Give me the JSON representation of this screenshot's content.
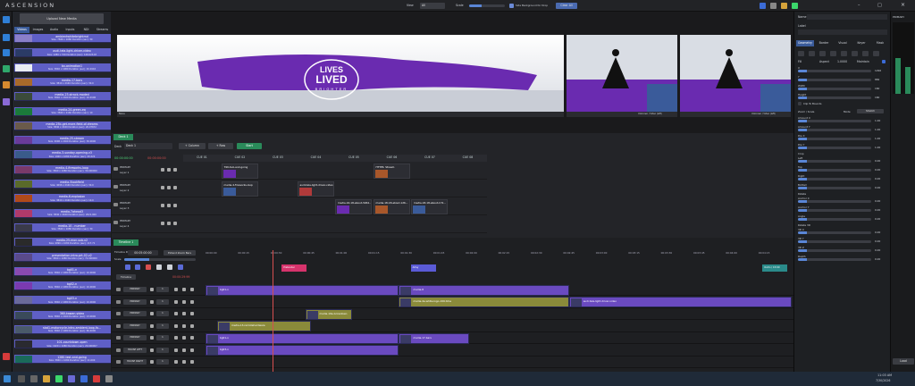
{
  "app": {
    "title": "ASCENSION"
  },
  "topbar": {
    "view_label": "View",
    "view_value": "All",
    "scale_label": "Scale",
    "scale_fraction": 0.35,
    "side_bg_label": "Side Background for Drop",
    "clear_all_label": "Clear All"
  },
  "media": {
    "upload_label": "Upload New Media",
    "tabs": [
      "Videos",
      "Images",
      "Audio",
      "Inputs",
      "NDI",
      "Streams"
    ],
    "items": [
      {
        "title": "ambientwhitebrightmd",
        "info": "Size: 7826 x 1080 Duration (sec): 30",
        "color": "#8a7fc8"
      },
      {
        "title": "audi-tela-light-driver-video",
        "info": "Size: 1280 x 720 Duration (sec): 126.023.67",
        "color": "#2b3b66"
      },
      {
        "title": "bx-animation1",
        "info": "Size: 3840 x 1080 Duration (sec): 40.0416",
        "color": "#e9ecf2"
      },
      {
        "title": "media-17-bars",
        "info": "Size: 3840 x 2160 Duration (sec): 30.0",
        "color": "#a86a2a"
      },
      {
        "title": "media-23-strack-moded",
        "info": "Size: 3840 x 2160 Duration (sec): 10.0106",
        "color": "#3b4b3a"
      },
      {
        "title": "media-24-green-eq",
        "info": "Size: 3840 x 2160 Duration (sec): 10",
        "color": "#1b7a3a"
      },
      {
        "title": "media-25b-get-more-field-of-dreams",
        "info": "Size: 3840 x 2160 Duration (sec): 20.07672",
        "color": "#6a5a4a"
      },
      {
        "title": "media-25-stream",
        "info": "Size: 4096 x 2160 Duration (sec): 30.0000",
        "color": "#6a3b9a"
      },
      {
        "title": "media-3-sunday-opening-v3",
        "info": "Size: 1920 x 1080 Duration (sec): 20.222",
        "color": "#3a5b8a"
      },
      {
        "title": "media-4-fireworks-loop",
        "info": "Size: 3840 x 1080 Duration (sec): 30.000000",
        "color": "#7a3a6a"
      },
      {
        "title": "media-5lookfield",
        "info": "Size: 4096 x 2160 Duration (sec): 30.0",
        "color": "#5a6a2a"
      },
      {
        "title": "media-6-explosion",
        "info": "Size: 3840 x 2160 Duration (sec): 10.0",
        "color": "#b04a1a"
      },
      {
        "title": "media-7ahead3",
        "info": "Size: 3840 x 2160 Duration (sec): 2021.000",
        "color": "#b03a6a"
      },
      {
        "title": "media-10 - number",
        "info": "Size: 3840 x 1080 Duration (sec): 30",
        "color": "#3a3a4a"
      },
      {
        "title": "media-25-mon-sub-v2",
        "info": "Size: 4096 x 1080 Duration (sec): 117.71",
        "color": "#2a2a2a"
      },
      {
        "title": "presentation-intro-prt-02-v2",
        "info": "Size: 3840 x 1080 Duration (sec): 72.000000",
        "color": "#5a4a8a"
      },
      {
        "title": "bg01-n",
        "info": "Size: 3840 x 1080 Duration (sec): 10.0000",
        "color": "#8a4ab0"
      },
      {
        "title": "bg02-n",
        "info": "Size: 3840 x 1080 Duration (sec): 10.0000",
        "color": "#7a3ab0"
      },
      {
        "title": "bg03-n",
        "info": "Size: 3840 x 1080 Duration (sec): 10.0000",
        "color": "#6a6a9a"
      },
      {
        "title": "360-kawan-video",
        "info": "Size: 3840 x 2160 Duration (sec): 13.0000",
        "color": "#3a4a5a"
      },
      {
        "title": "stat1-motorcycle-intro-ambient-loop-fo...",
        "info": "Size: 3840 x 1080 Duration (sec): 80.4000",
        "color": "#4a5a6a"
      },
      {
        "title": "101-countdown-open",
        "info": "Size: 1920 x 1080 Duration (sec): 20.000007",
        "color": "#2a2a30"
      },
      {
        "title": "1280-test-and-going",
        "info": "Size: 3840 x 1080 Duration (sec): 11.000",
        "color": "#1a6a5a"
      }
    ]
  },
  "preview": {
    "main_label": "None",
    "caption_left": "None",
    "caption_mid": "Unknown / Video (left)",
    "caption_right": "Unknown / Video (left)",
    "slide_text_1": "LIVES",
    "slide_text_2": "LIVED",
    "slide_text_3": "BRIGHTER"
  },
  "deck": {
    "tab_label": "Deck 1",
    "deck_label": "Deck",
    "deck_name": "Deck 1",
    "add_column": "+ Column",
    "add_row": "+ Row",
    "start": "Start",
    "time_a": "00:00:00:00",
    "time_b": "00:00:00:00",
    "cues": [
      "CUE 01",
      "CUE 02",
      "CUE 03",
      "CUE 04",
      "CUE 05",
      "CUE 06",
      "CUE 07",
      "CUE 08"
    ],
    "rows": [
      {
        "screen": "PRIMARY",
        "layer": "Layer 1"
      },
      {
        "screen": "PRIMARY",
        "layer": "Layer 2"
      },
      {
        "screen": "PRIMARY",
        "layer": "Layer 3"
      },
      {
        "screen": "PRIMARY",
        "layer": "Layer 4"
      }
    ],
    "clips": [
      {
        "label": "799-tool-and-going",
        "sub": "00:00:00:00",
        "row": 0,
        "col": 1
      },
      {
        "label": "HTTPS: Stream",
        "sub": "",
        "row": 0,
        "col": 5
      },
      {
        "label": "media-4-fireworks-loop",
        "sub": "",
        "row": 1,
        "col": 1
      },
      {
        "label": "audi-tela-light-driver-video",
        "sub": "",
        "row": 1,
        "col": 3
      },
      {
        "label": "media-16-18-about-3264...",
        "sub": "",
        "row": 2,
        "col": 4
      },
      {
        "label": "media-18-18-about-126...",
        "sub": "",
        "row": 2,
        "col": 5
      },
      {
        "label": "media-18-18-about-172...",
        "sub": "",
        "row": 2,
        "col": 6
      }
    ]
  },
  "timeline": {
    "tab_label": "Timeline 1",
    "timeline_label": "Timeline Duration",
    "duration": "00:05:00:00",
    "extend_label": "Extend Zoom Bars",
    "scale_label": "Scale",
    "time": "00:00:29:99",
    "ticks": [
      "00:00:00",
      "00:00:15",
      "00:00:30",
      "00:00:45",
      "00:01:00",
      "00:01:15",
      "00:01:30",
      "00:01:45",
      "00:02:00",
      "00:02:15",
      "00:02:30",
      "00:02:45",
      "00:03:00",
      "00:03:15",
      "00:03:30",
      "00:03:45",
      "00:04:00",
      "00:04:15"
    ],
    "markers": [
      {
        "label": "Pretender",
        "pos": 0.13,
        "color": "#d6336c"
      },
      {
        "label": "Artsy",
        "pos": 0.35,
        "color": "#5a5ad6"
      },
      {
        "label": "Outro / 15:00",
        "pos": 0.95,
        "color": "#2a8a8a"
      }
    ],
    "tracks": [
      {
        "screen": "PRIMARY",
        "layer": "1"
      },
      {
        "screen": "PRIMARY",
        "layer": "1"
      },
      {
        "screen": "PRIMARY",
        "layer": "1"
      },
      {
        "screen": "PRIMARY",
        "layer": "1"
      },
      {
        "screen": "PRIMARY",
        "layer": "1"
      },
      {
        "screen": "HOUSE LEFT",
        "layer": "1"
      },
      {
        "screen": "HOUSE RIGHT",
        "layer": "1"
      }
    ],
    "clips": [
      {
        "label": "bg01-n",
        "track": 0,
        "start": 0.0,
        "end": 0.33,
        "color": "#6a4ac0"
      },
      {
        "label": "media-8",
        "track": 0,
        "start": 0.33,
        "end": 0.62,
        "color": "#6a4ac0"
      },
      {
        "label": "media-4a-white-logo-199-time",
        "track": 1,
        "start": 0.33,
        "end": 0.62,
        "color": "#8a8a3a"
      },
      {
        "label": "audi-tela-light-driver-video",
        "track": 1,
        "start": 0.62,
        "end": 1.0,
        "color": "#6a4ac0"
      },
      {
        "label": "media-19a-Growdown",
        "track": 2,
        "start": 0.17,
        "end": 0.25,
        "color": "#8a8a3a"
      },
      {
        "label": "media-13-remotehardware",
        "track": 3,
        "start": 0.02,
        "end": 0.18,
        "color": "#8a8a3a"
      },
      {
        "label": "bg01-n",
        "track": 4,
        "start": 0.0,
        "end": 0.33,
        "color": "#6a4ac0"
      },
      {
        "label": "media-17-bars",
        "track": 4,
        "start": 0.33,
        "end": 0.45,
        "color": "#6a4ac0"
      },
      {
        "label": "bg03-n",
        "track": 5,
        "start": 0.0,
        "end": 0.33,
        "color": "#6a4ac0"
      }
    ]
  },
  "props": {
    "name_label": "Name",
    "label_label": "Label",
    "tabs": [
      "Geometry",
      "Border",
      "Visual",
      "Keyer",
      "Mask"
    ],
    "fill_label": "Fill",
    "aspect_label": "Aspect",
    "aspect_value": "1.0000",
    "maintain_label": "Maintain",
    "fields": [
      {
        "name": "X",
        "value": "1296"
      },
      {
        "name": "Y",
        "value": "882"
      },
      {
        "name": "Width",
        "value": "160"
      },
      {
        "name": "Height",
        "value": "160"
      }
    ],
    "clip_label": "Clip To Bounds",
    "zoom_label": "Zoom / Scale",
    "mode_label": "Mode",
    "mode_value": "Stretch",
    "params": [
      {
        "name": "Amount X",
        "value": "1.00"
      },
      {
        "name": "Amount Y",
        "value": "1.00"
      },
      {
        "name": "Pos X",
        "value": "1.00"
      },
      {
        "name": "Pos Y",
        "value": "1.00"
      }
    ],
    "crop_label": "Crop",
    "crop": [
      {
        "name": "Left",
        "value": "0.00"
      },
      {
        "name": "Top",
        "value": "0.00"
      },
      {
        "name": "Right",
        "value": "0.00"
      },
      {
        "name": "Bottom",
        "value": "0.00"
      }
    ],
    "rotate_label": "Rotate",
    "rotate": [
      {
        "name": "Anchor X",
        "value": "0.00"
      },
      {
        "name": "Anchor Y",
        "value": "0.00"
      },
      {
        "name": "Angle",
        "value": "0.00"
      }
    ],
    "rotate3d_label": "Rotate 3D",
    "rotate3d": [
      {
        "name": "3D X",
        "value": "0.00"
      },
      {
        "name": "3D Y",
        "value": "0.00"
      },
      {
        "name": "3D Z",
        "value": "0.00"
      },
      {
        "name": "Depth",
        "value": "0.00"
      }
    ]
  },
  "meters": {
    "label": "PRIMARY",
    "button": "Load"
  },
  "taskbar": {
    "time": "11:03 AM",
    "date": "7/30/2026"
  }
}
